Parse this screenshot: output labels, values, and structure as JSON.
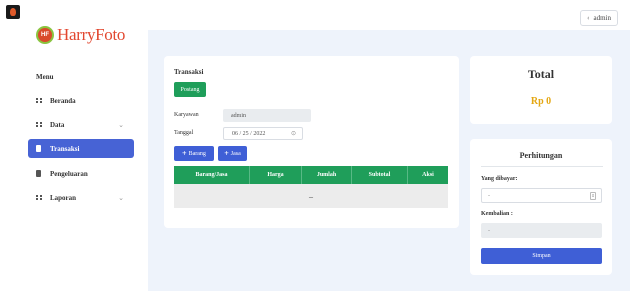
{
  "header": {
    "user_label": "admin"
  },
  "brand": {
    "initials": "HF",
    "name": "HarryFoto"
  },
  "sidebar": {
    "title": "Menu",
    "items": [
      {
        "label": "Beranda",
        "icon": "grid-icon"
      },
      {
        "label": "Data",
        "icon": "grid-icon",
        "expandable": true
      },
      {
        "label": "Transaksi",
        "icon": "document-icon",
        "active": true
      },
      {
        "label": "Pengeluaran",
        "icon": "document-icon"
      },
      {
        "label": "Laporan",
        "icon": "grid-icon",
        "expandable": true
      }
    ]
  },
  "transaksi": {
    "title": "Transaksi",
    "posting_label": "Postang",
    "karyawan_label": "Karyawan",
    "karyawan_value": "admin",
    "tanggal_label": "Tanggal",
    "tanggal_value": "06 / 25 / 2022",
    "btn_barang": "Barang",
    "btn_jasa": "Jasa",
    "table": {
      "columns": [
        "Barang/Jasa",
        "Harga",
        "Jumlah",
        "Subtotal",
        "Aksi"
      ],
      "empty_text": "–"
    }
  },
  "total": {
    "title": "Total",
    "value": "Rp 0"
  },
  "perhitungan": {
    "title": "Perhitungan",
    "dibayar_label": "Yang dibayar:",
    "dibayar_value": "-",
    "kembalian_label": "Kembalian :",
    "kembalian_value": "-",
    "simpan_label": "Simpan"
  },
  "colors": {
    "primary": "#4763d5",
    "success": "#1f9e5a",
    "warning": "#e4a712",
    "background": "#eef3fb"
  }
}
